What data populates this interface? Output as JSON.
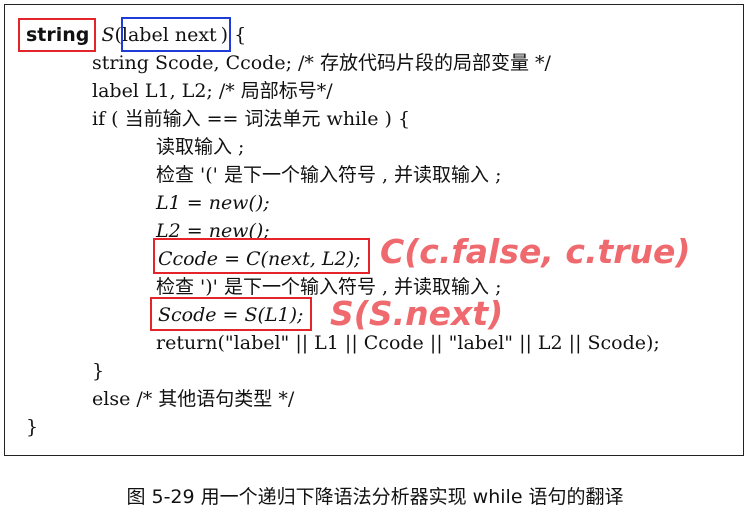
{
  "code": {
    "l1": {
      "ret_type": "string",
      "fn": "S",
      "open_paren": "(",
      "param": "label next",
      "close": ") {"
    },
    "l2": "string Scode, Ccode; /* 存放代码片段的局部变量 */",
    "l3": "label L1, L2; /* 局部标号*/",
    "l4": "if ( 当前输入 == 词法单元 while ) {",
    "l5": "读取输入 ;",
    "l6": "检查 '(' 是下一个输入符号 , 并读取输入 ;",
    "l7": "L1 = new();",
    "l8": "L2 = new();",
    "l9": "Ccode = C(next, L2);",
    "l10": "检查 ')' 是下一个输入符号 , 并读取输入 ;",
    "l11": "Scode = S(L1);",
    "l12": "return(\"label\" || L1 || Ccode || \"label\" || L2 || Scode);",
    "l13": "}",
    "l14": "else /* 其他语句类型 */",
    "l15": "}"
  },
  "annotations": {
    "c_call": "C(c.false, c.true)",
    "s_call": "S(S.next)"
  },
  "caption": "图 5-29 用一个递归下降语法分析器实现 while 语句的翻译",
  "colors": {
    "annotation_box": "#e3242b",
    "param_box": "#1f3bd8",
    "annotation_text": "#ef6a6e"
  }
}
